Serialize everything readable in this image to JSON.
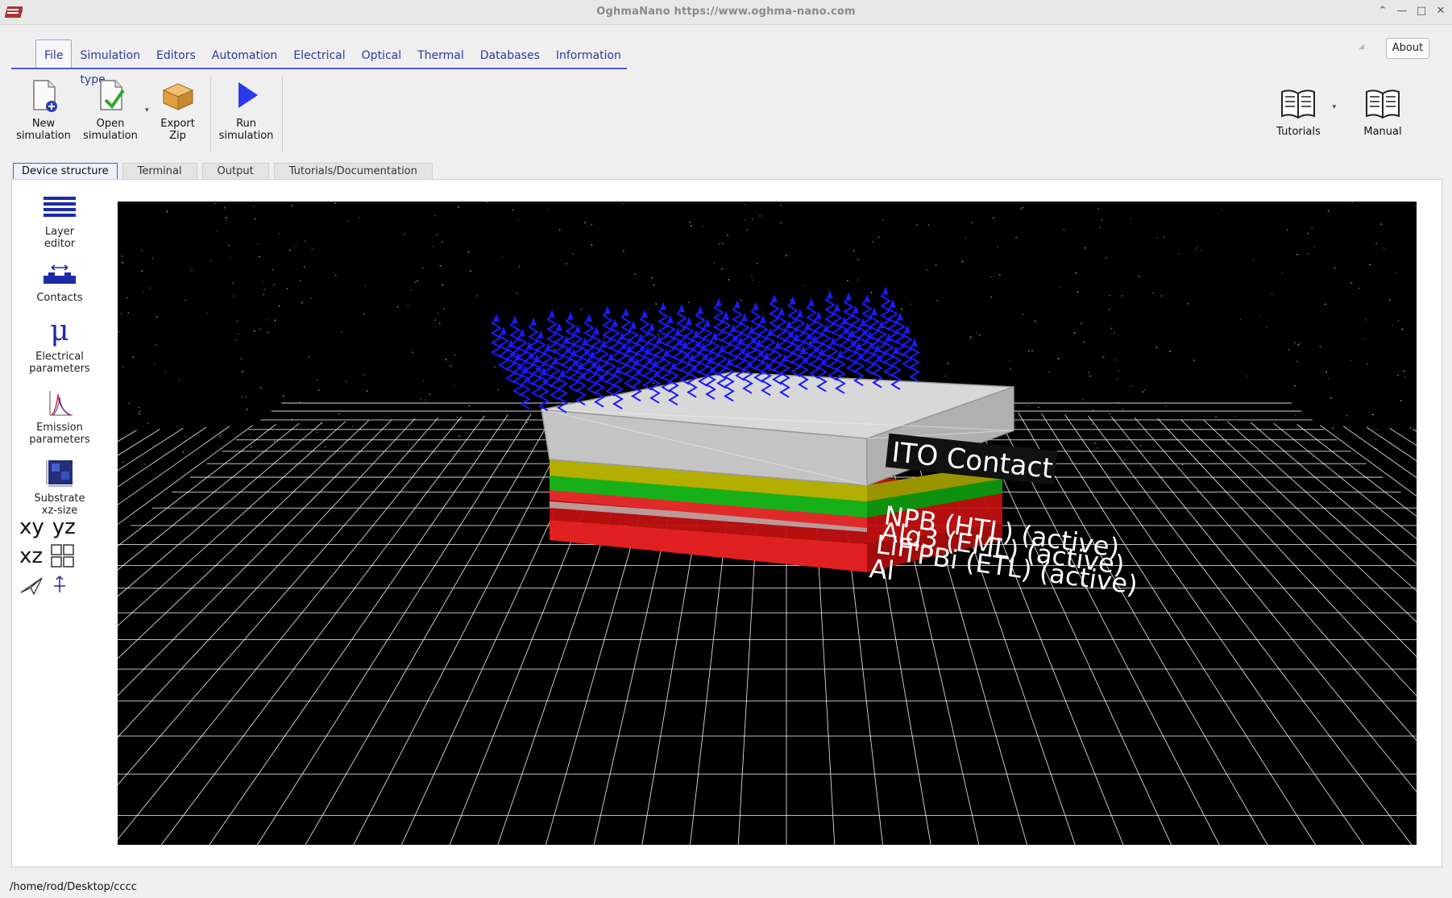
{
  "window": {
    "title": "OghmaNano https://www.oghma-nano.com"
  },
  "menu": {
    "tabs": [
      "File",
      "Simulation type",
      "Editors",
      "Automation",
      "Electrical",
      "Optical",
      "Thermal",
      "Databases",
      "Information"
    ],
    "active_tab": "File",
    "about_label": "About"
  },
  "toolbar": {
    "new_simulation": "New\nsimulation",
    "open_simulation": "Open\nsimulation",
    "export_zip": "Export\nZip",
    "run_simulation": "Run\nsimulation",
    "tutorials": "Tutorials",
    "manual": "Manual"
  },
  "content_tabs": [
    "Device structure",
    "Terminal",
    "Output",
    "Tutorials/Documentation"
  ],
  "sidebar": {
    "layer_editor": "Layer\neditor",
    "contacts": "Contacts",
    "electrical_parameters": "Electrical\nparameters",
    "emission_parameters": "Emission\nparameters",
    "substrate_xz_size": "Substrate\nxz-size",
    "view_xy": "xy",
    "view_yz": "yz",
    "view_xz": "xz",
    "mu_symbol": "μ"
  },
  "scene": {
    "labels": {
      "ito": "ITO Contact",
      "npb": "NPB (HTL) (active)",
      "alq3": "Alq3 (EML) (active)",
      "tpbi": "TPBi (ETL) (active)",
      "lif": "LiF",
      "al": "Al"
    },
    "colors": {
      "ito": "#c8c8c8",
      "npb": "#b8b000",
      "alq3": "#10b010",
      "tpbi": "#d01010",
      "light": "#1a1aff",
      "grid": "#ffffff"
    }
  },
  "status": {
    "path": "/home/rod/Desktop/cccc"
  }
}
